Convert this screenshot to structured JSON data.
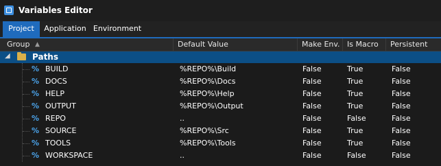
{
  "window": {
    "title": "Variables Editor"
  },
  "tabs": [
    {
      "label": "Project",
      "active": true
    },
    {
      "label": "Application",
      "active": false
    },
    {
      "label": "Environment",
      "active": false
    }
  ],
  "columns": {
    "group": "Group",
    "default_value": "Default Value",
    "make_env": "Make Env.",
    "is_macro": "Is Macro",
    "persistent": "Persistent"
  },
  "group": {
    "label": "Paths",
    "expander": "◢"
  },
  "rows": [
    {
      "name": "BUILD",
      "default_value": "%REPO%\\Build",
      "make_env": "False",
      "is_macro": "True",
      "persistent": "False"
    },
    {
      "name": "DOCS",
      "default_value": "%REPO%\\Docs",
      "make_env": "False",
      "is_macro": "True",
      "persistent": "False"
    },
    {
      "name": "HELP",
      "default_value": "%REPO%\\Help",
      "make_env": "False",
      "is_macro": "True",
      "persistent": "False"
    },
    {
      "name": "OUTPUT",
      "default_value": "%REPO%\\Output",
      "make_env": "False",
      "is_macro": "True",
      "persistent": "False"
    },
    {
      "name": "REPO",
      "default_value": "..",
      "make_env": "False",
      "is_macro": "False",
      "persistent": "False"
    },
    {
      "name": "SOURCE",
      "default_value": "%REPO%\\Src",
      "make_env": "False",
      "is_macro": "True",
      "persistent": "False"
    },
    {
      "name": "TOOLS",
      "default_value": "%REPO%\\Tools",
      "make_env": "False",
      "is_macro": "True",
      "persistent": "False"
    },
    {
      "name": "WORKSPACE",
      "default_value": "..",
      "make_env": "False",
      "is_macro": "False",
      "persistent": "False"
    }
  ],
  "icons": {
    "variable": "%",
    "sort_indicator": "▲"
  },
  "colors": {
    "accent": "#1f6bbd",
    "group_row": "#0c4f86",
    "variable_icon": "#4ba3ea"
  }
}
